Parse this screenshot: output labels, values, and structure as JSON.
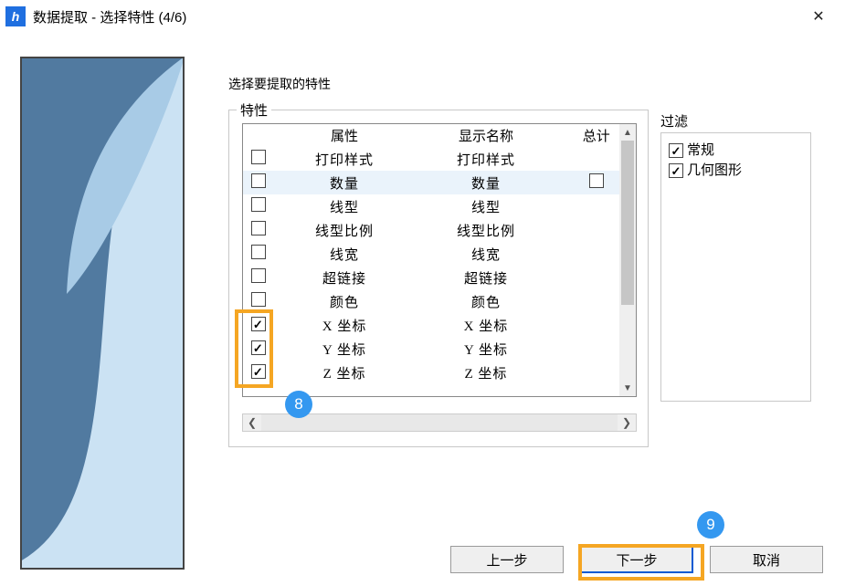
{
  "titlebar": {
    "app_icon_glyph": "h",
    "title": "数据提取 - 选择特性 (4/6)"
  },
  "heading": "选择要提取的特性",
  "props_group_label": "特性",
  "filter_group_label": "过滤",
  "table": {
    "headers": {
      "attr": "属性",
      "disp": "显示名称",
      "total": "总计"
    },
    "rows": [
      {
        "checked": false,
        "attr": "打印样式",
        "disp": "打印样式",
        "selected": false,
        "has_total_box": false
      },
      {
        "checked": false,
        "attr": "数量",
        "disp": "数量",
        "selected": true,
        "has_total_box": true
      },
      {
        "checked": false,
        "attr": "线型",
        "disp": "线型",
        "selected": false,
        "has_total_box": false
      },
      {
        "checked": false,
        "attr": "线型比例",
        "disp": "线型比例",
        "selected": false,
        "has_total_box": false
      },
      {
        "checked": false,
        "attr": "线宽",
        "disp": "线宽",
        "selected": false,
        "has_total_box": false
      },
      {
        "checked": false,
        "attr": "超链接",
        "disp": "超链接",
        "selected": false,
        "has_total_box": false
      },
      {
        "checked": false,
        "attr": "颜色",
        "disp": "颜色",
        "selected": false,
        "has_total_box": false
      },
      {
        "checked": true,
        "attr": "X 坐标",
        "disp": "X 坐标",
        "selected": false,
        "has_total_box": false
      },
      {
        "checked": true,
        "attr": "Y 坐标",
        "disp": "Y 坐标",
        "selected": false,
        "has_total_box": false
      },
      {
        "checked": true,
        "attr": "Z 坐标",
        "disp": "Z 坐标",
        "selected": false,
        "has_total_box": false
      }
    ]
  },
  "filter": {
    "items": [
      {
        "checked": true,
        "label": "常规"
      },
      {
        "checked": true,
        "label": "几何图形"
      }
    ]
  },
  "buttons": {
    "prev": "上一步",
    "next": "下一步",
    "cancel": "取消"
  },
  "callouts": {
    "badge_checks": "8",
    "badge_next": "9"
  }
}
